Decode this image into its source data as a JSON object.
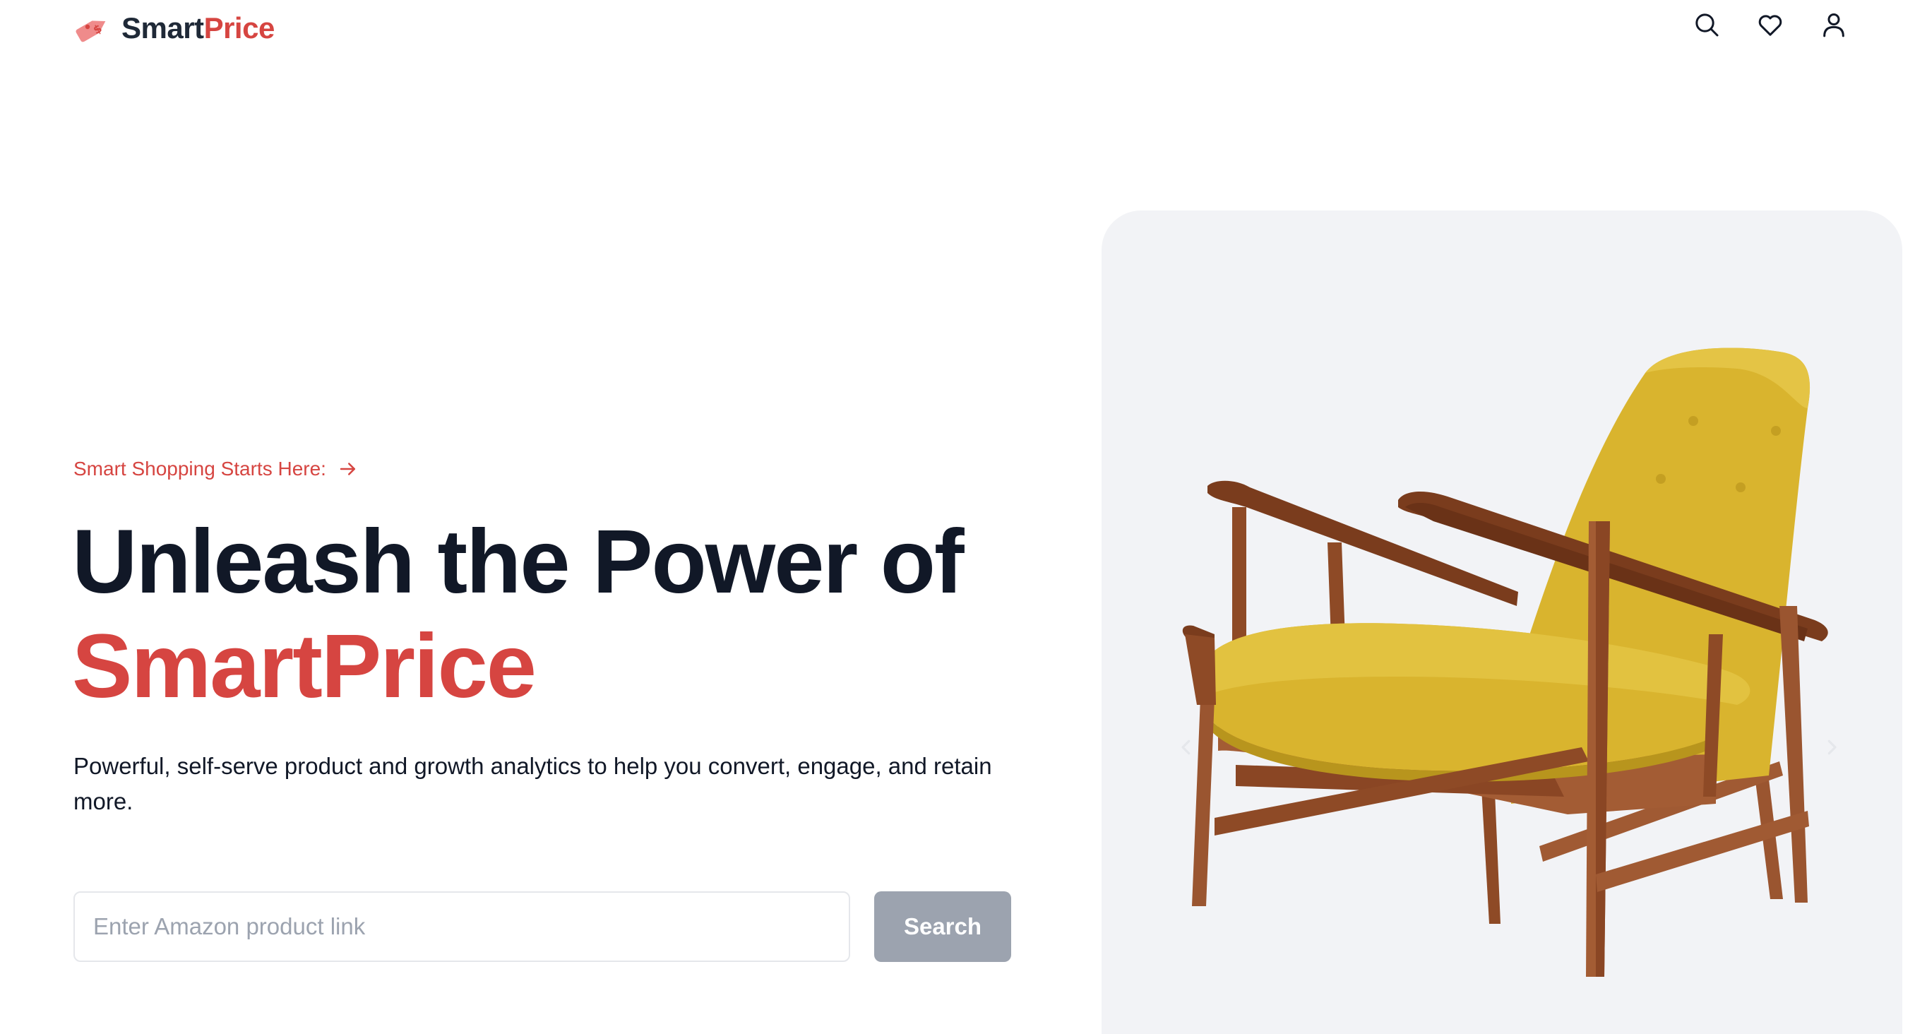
{
  "brand": {
    "name_part1": "Smart",
    "name_part2": "Price",
    "accent_color": "#d64541",
    "logo_icon": "price-tag-icon"
  },
  "header": {
    "icons": [
      "search-icon",
      "heart-icon",
      "user-icon"
    ]
  },
  "hero": {
    "eyebrow": "Smart Shopping Starts Here:",
    "eyebrow_icon": "arrow-right-icon",
    "headline_line1": "Unleash the Power of",
    "headline_line2": "SmartPrice",
    "description": "Powerful, self-serve product and growth analytics to help you convert, engage, and retain more."
  },
  "search": {
    "placeholder": "Enter Amazon product link",
    "value": "",
    "button_label": "Search",
    "button_color": "#9ca3af"
  },
  "carousel": {
    "image_subject": "yellow-mid-century-armchair",
    "prev_icon": "chevron-left-icon",
    "next_icon": "chevron-right-icon",
    "background": "#f2f3f6"
  }
}
